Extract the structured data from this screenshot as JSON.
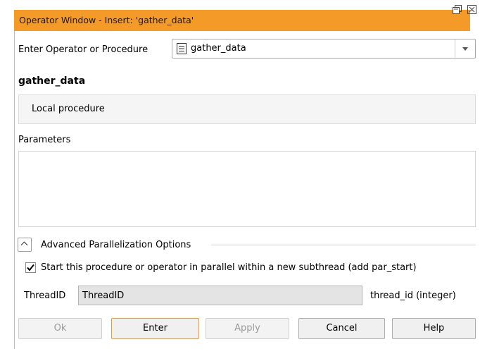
{
  "window": {
    "title": "Operator Window - Insert: 'gather_data'",
    "float_icon": "float-icon",
    "close_icon": "close-icon"
  },
  "operator_select": {
    "label": "Enter Operator or Procedure",
    "value": "gather_data",
    "icon": "document-icon"
  },
  "operator": {
    "name": "gather_data",
    "description": "Local procedure"
  },
  "parameters": {
    "label": "Parameters"
  },
  "advanced": {
    "label": "Advanced Parallelization Options",
    "parallel_checkbox_label": "Start this procedure or operator in parallel within a new subthread (add par_start)",
    "parallel_checked": true,
    "thread_label": "ThreadID",
    "thread_value": "ThreadID",
    "thread_type": "thread_id (integer)"
  },
  "buttons": {
    "ok": "Ok",
    "enter": "Enter",
    "apply": "Apply",
    "cancel": "Cancel",
    "help": "Help"
  },
  "colors": {
    "title_bar": "#f39a28"
  }
}
